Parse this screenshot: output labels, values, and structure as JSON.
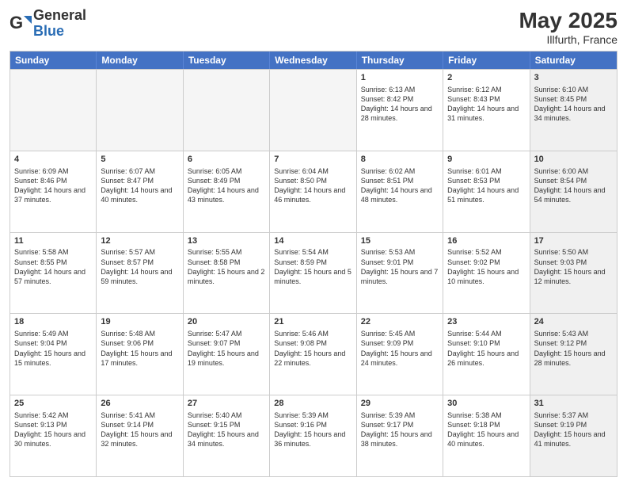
{
  "logo": {
    "general": "General",
    "blue": "Blue"
  },
  "title": "May 2025",
  "subtitle": "Illfurth, France",
  "header_days": [
    "Sunday",
    "Monday",
    "Tuesday",
    "Wednesday",
    "Thursday",
    "Friday",
    "Saturday"
  ],
  "weeks": [
    [
      {
        "day": "",
        "info": "",
        "empty": true
      },
      {
        "day": "",
        "info": "",
        "empty": true
      },
      {
        "day": "",
        "info": "",
        "empty": true
      },
      {
        "day": "",
        "info": "",
        "empty": true
      },
      {
        "day": "1",
        "info": "Sunrise: 6:13 AM\nSunset: 8:42 PM\nDaylight: 14 hours and 28 minutes."
      },
      {
        "day": "2",
        "info": "Sunrise: 6:12 AM\nSunset: 8:43 PM\nDaylight: 14 hours and 31 minutes."
      },
      {
        "day": "3",
        "info": "Sunrise: 6:10 AM\nSunset: 8:45 PM\nDaylight: 14 hours and 34 minutes.",
        "shaded": true
      }
    ],
    [
      {
        "day": "4",
        "info": "Sunrise: 6:09 AM\nSunset: 8:46 PM\nDaylight: 14 hours and 37 minutes."
      },
      {
        "day": "5",
        "info": "Sunrise: 6:07 AM\nSunset: 8:47 PM\nDaylight: 14 hours and 40 minutes."
      },
      {
        "day": "6",
        "info": "Sunrise: 6:05 AM\nSunset: 8:49 PM\nDaylight: 14 hours and 43 minutes."
      },
      {
        "day": "7",
        "info": "Sunrise: 6:04 AM\nSunset: 8:50 PM\nDaylight: 14 hours and 46 minutes."
      },
      {
        "day": "8",
        "info": "Sunrise: 6:02 AM\nSunset: 8:51 PM\nDaylight: 14 hours and 48 minutes."
      },
      {
        "day": "9",
        "info": "Sunrise: 6:01 AM\nSunset: 8:53 PM\nDaylight: 14 hours and 51 minutes."
      },
      {
        "day": "10",
        "info": "Sunrise: 6:00 AM\nSunset: 8:54 PM\nDaylight: 14 hours and 54 minutes.",
        "shaded": true
      }
    ],
    [
      {
        "day": "11",
        "info": "Sunrise: 5:58 AM\nSunset: 8:55 PM\nDaylight: 14 hours and 57 minutes."
      },
      {
        "day": "12",
        "info": "Sunrise: 5:57 AM\nSunset: 8:57 PM\nDaylight: 14 hours and 59 minutes."
      },
      {
        "day": "13",
        "info": "Sunrise: 5:55 AM\nSunset: 8:58 PM\nDaylight: 15 hours and 2 minutes."
      },
      {
        "day": "14",
        "info": "Sunrise: 5:54 AM\nSunset: 8:59 PM\nDaylight: 15 hours and 5 minutes."
      },
      {
        "day": "15",
        "info": "Sunrise: 5:53 AM\nSunset: 9:01 PM\nDaylight: 15 hours and 7 minutes."
      },
      {
        "day": "16",
        "info": "Sunrise: 5:52 AM\nSunset: 9:02 PM\nDaylight: 15 hours and 10 minutes."
      },
      {
        "day": "17",
        "info": "Sunrise: 5:50 AM\nSunset: 9:03 PM\nDaylight: 15 hours and 12 minutes.",
        "shaded": true
      }
    ],
    [
      {
        "day": "18",
        "info": "Sunrise: 5:49 AM\nSunset: 9:04 PM\nDaylight: 15 hours and 15 minutes."
      },
      {
        "day": "19",
        "info": "Sunrise: 5:48 AM\nSunset: 9:06 PM\nDaylight: 15 hours and 17 minutes."
      },
      {
        "day": "20",
        "info": "Sunrise: 5:47 AM\nSunset: 9:07 PM\nDaylight: 15 hours and 19 minutes."
      },
      {
        "day": "21",
        "info": "Sunrise: 5:46 AM\nSunset: 9:08 PM\nDaylight: 15 hours and 22 minutes."
      },
      {
        "day": "22",
        "info": "Sunrise: 5:45 AM\nSunset: 9:09 PM\nDaylight: 15 hours and 24 minutes."
      },
      {
        "day": "23",
        "info": "Sunrise: 5:44 AM\nSunset: 9:10 PM\nDaylight: 15 hours and 26 minutes."
      },
      {
        "day": "24",
        "info": "Sunrise: 5:43 AM\nSunset: 9:12 PM\nDaylight: 15 hours and 28 minutes.",
        "shaded": true
      }
    ],
    [
      {
        "day": "25",
        "info": "Sunrise: 5:42 AM\nSunset: 9:13 PM\nDaylight: 15 hours and 30 minutes."
      },
      {
        "day": "26",
        "info": "Sunrise: 5:41 AM\nSunset: 9:14 PM\nDaylight: 15 hours and 32 minutes."
      },
      {
        "day": "27",
        "info": "Sunrise: 5:40 AM\nSunset: 9:15 PM\nDaylight: 15 hours and 34 minutes."
      },
      {
        "day": "28",
        "info": "Sunrise: 5:39 AM\nSunset: 9:16 PM\nDaylight: 15 hours and 36 minutes."
      },
      {
        "day": "29",
        "info": "Sunrise: 5:39 AM\nSunset: 9:17 PM\nDaylight: 15 hours and 38 minutes."
      },
      {
        "day": "30",
        "info": "Sunrise: 5:38 AM\nSunset: 9:18 PM\nDaylight: 15 hours and 40 minutes."
      },
      {
        "day": "31",
        "info": "Sunrise: 5:37 AM\nSunset: 9:19 PM\nDaylight: 15 hours and 41 minutes.",
        "shaded": true
      }
    ]
  ]
}
